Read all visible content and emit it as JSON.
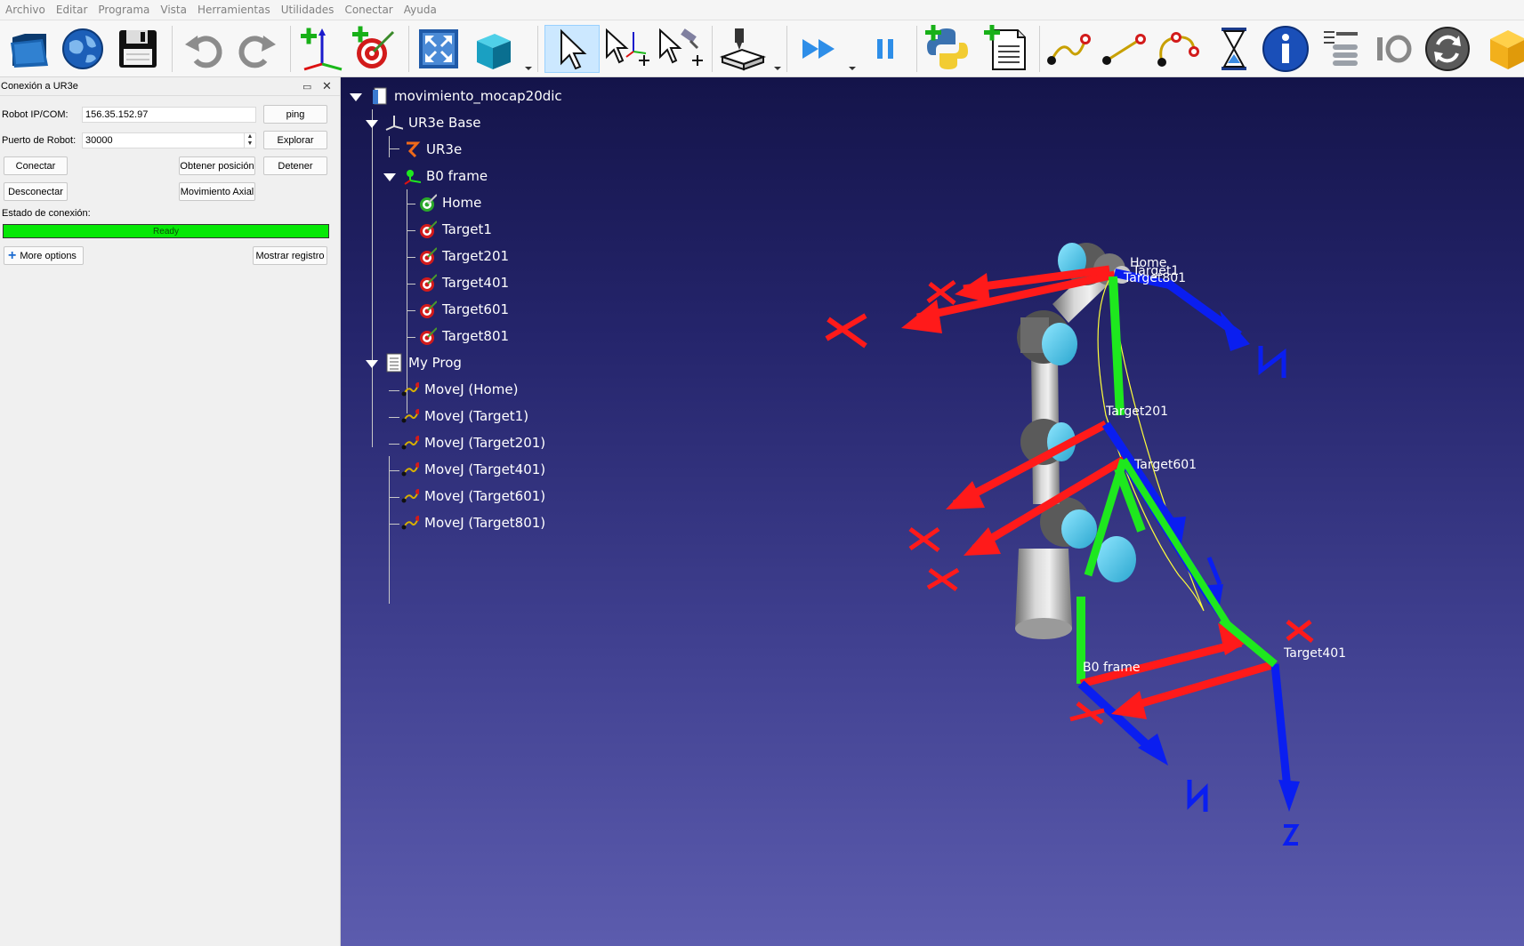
{
  "menu": [
    "Archivo",
    "Editar",
    "Programa",
    "Vista",
    "Herramientas",
    "Utilidades",
    "Conectar",
    "Ayuda"
  ],
  "toolbar_icons": [
    "open-icon",
    "web-library-icon",
    "save-icon",
    "undo-icon",
    "redo-icon",
    "add-reference-frame-icon",
    "add-target-icon",
    "fit-all-icon",
    "view-cube-icon",
    "select-icon",
    "move-reference-frame-icon",
    "move-tool-icon",
    "3d-print-icon",
    "run-program-icon",
    "pause-icon",
    "add-python-program-icon",
    "add-program-icon",
    "move-joint-icon",
    "move-linear-icon",
    "move-circular-icon",
    "pause-time-icon",
    "info-icon",
    "instruction-list-icon",
    "io-icon",
    "reload-icon",
    "package-icon"
  ],
  "panel": {
    "title": "Conexión a UR3e",
    "robot_ip_label": "Robot IP/COM:",
    "robot_ip_value": "156.35.152.97",
    "ping_label": "ping",
    "port_label": "Puerto de Robot:",
    "port_value": "30000",
    "explore_label": "Explorar",
    "connect_label": "Conectar",
    "get_position_label": "Obtener posición",
    "stop_label": "Detener",
    "disconnect_label": "Desconectar",
    "axial_move_label": "Movimiento Axial",
    "status_label": "Estado de conexión:",
    "status_value": "Ready",
    "more_options_label": "More options",
    "show_log_label": "Mostrar registro"
  },
  "tree": {
    "station": "movimiento_mocap20dic",
    "robot_base": "UR3e Base",
    "robot": "UR3e",
    "frame": "B0 frame",
    "targets": [
      "Home",
      "Target1",
      "Target201",
      "Target401",
      "Target601",
      "Target801"
    ],
    "program": "My Prog",
    "instructions": [
      "MoveJ (Home)",
      "MoveJ (Target1)",
      "MoveJ (Target201)",
      "MoveJ (Target401)",
      "MoveJ (Target601)",
      "MoveJ (Target801)"
    ]
  },
  "scene_labels": {
    "home": "Home",
    "target1": "Target1",
    "target801": "Target801",
    "target201": "Target201",
    "target601": "Target601",
    "target401": "Target401",
    "b0frame": "B0 frame"
  },
  "colors": {
    "axis_x": "#ff1a1a",
    "axis_y": "#1ee81e",
    "axis_z": "#0a1ef0",
    "status_ok": "#06e806",
    "viewport_top": "#14144a",
    "viewport_bottom": "#5c5cae"
  }
}
